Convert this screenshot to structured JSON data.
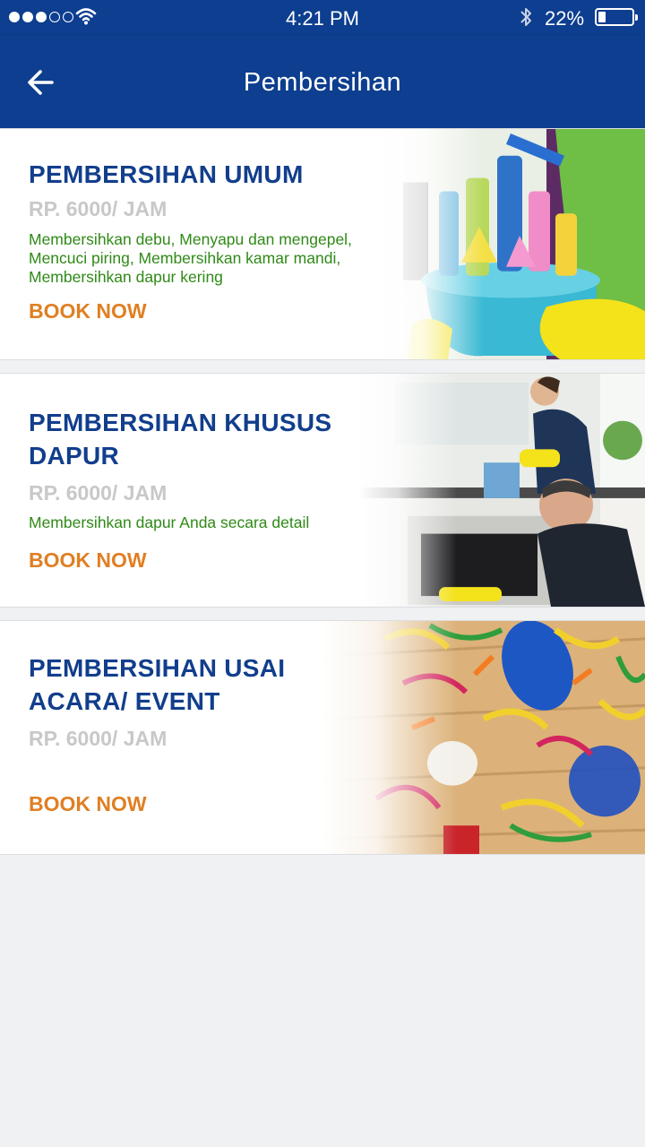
{
  "status_bar": {
    "time": "4:21 PM",
    "battery_percent": "22%",
    "battery_level": 0.22,
    "signal_bars_filled": 3,
    "signal_bars_total": 5
  },
  "app_bar": {
    "title": "Pembersihan",
    "back_icon": "arrow-left-icon"
  },
  "colors": {
    "primary": "#0d3e8f",
    "title_text": "#123e8c",
    "price_text": "#c8c8c8",
    "description_text": "#2f8a17",
    "book_now": "#e07f23",
    "background": "#f0f1f3"
  },
  "services": [
    {
      "title": "PEMBERSIHAN UMUM",
      "price": "RP. 6000/ JAM",
      "description": "Membersihkan debu, Menyapu dan mengepel, Mencuci piring, Membersihkan kamar mandi, Membersihkan dapur kering",
      "book_label": "BOOK NOW"
    },
    {
      "title": "PEMBERSIHAN KHUSUS DAPUR",
      "price": "RP. 6000/ JAM",
      "description": "Membersihkan dapur Anda secara detail",
      "book_label": "BOOK NOW"
    },
    {
      "title": "PEMBERSIHAN USAI ACARA/ EVENT",
      "price": "RP. 6000/ JAM",
      "description": "",
      "book_label": "BOOK NOW"
    }
  ]
}
